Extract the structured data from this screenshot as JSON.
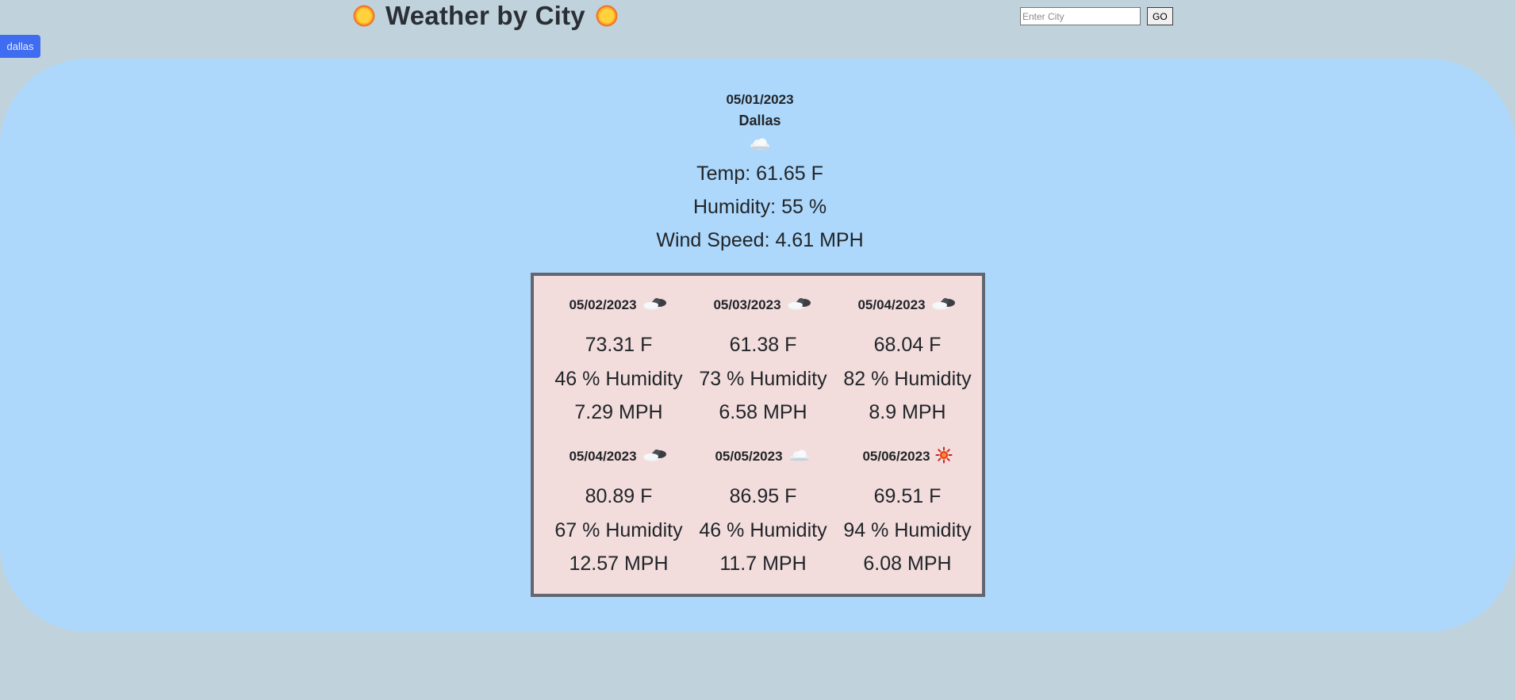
{
  "header": {
    "title": "Weather by City",
    "left_icon": "sun-icon",
    "right_icon": "sun-icon"
  },
  "search": {
    "placeholder": "Enter City",
    "value": "",
    "button_label": "GO"
  },
  "history": {
    "items": [
      "dallas"
    ]
  },
  "current": {
    "date": "05/01/2023",
    "city": "Dallas",
    "icon": "cloud-icon",
    "temp": "Temp: 61.65 F",
    "humidity": "Humidity: 55 %",
    "wind": "Wind Speed: 4.61 MPH"
  },
  "forecast": [
    {
      "date": "05/02/2023",
      "icon": "cloud-rain-icon",
      "temp": "73.31 F",
      "humidity": "46 % Humidity",
      "wind": "7.29 MPH"
    },
    {
      "date": "05/03/2023",
      "icon": "cloud-rain-icon",
      "temp": "61.38 F",
      "humidity": "73 % Humidity",
      "wind": "6.58 MPH"
    },
    {
      "date": "05/04/2023",
      "icon": "cloud-rain-icon",
      "temp": "68.04 F",
      "humidity": "82 % Humidity",
      "wind": "8.9 MPH"
    },
    {
      "date": "05/04/2023",
      "icon": "cloud-rain-icon",
      "temp": "80.89 F",
      "humidity": "67 % Humidity",
      "wind": "12.57 MPH"
    },
    {
      "date": "05/05/2023",
      "icon": "cloud-icon",
      "temp": "86.95 F",
      "humidity": "46 % Humidity",
      "wind": "11.7 MPH"
    },
    {
      "date": "05/06/2023",
      "icon": "sun-icon",
      "temp": "69.51 F",
      "humidity": "94 % Humidity",
      "wind": "6.08 MPH"
    }
  ],
  "colors": {
    "page_bg": "#c0d2dc",
    "panel_bg": "#add8fb",
    "forecast_bg": "#f2dcdc",
    "forecast_border": "#626671",
    "history_button": "#3f6cf0"
  }
}
